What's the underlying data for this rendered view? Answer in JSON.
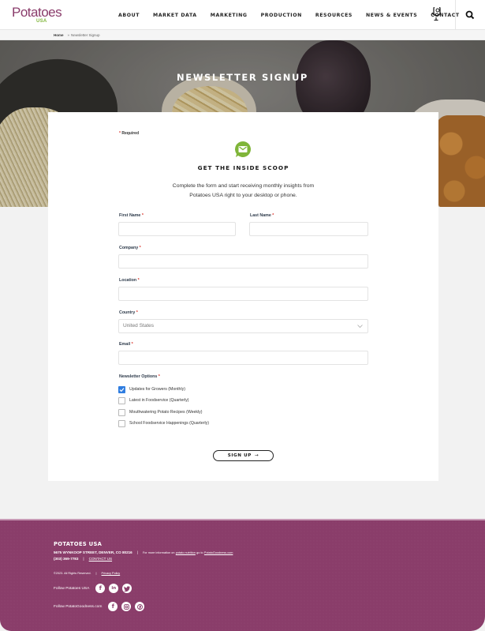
{
  "header": {
    "logo_text": "Potatoes",
    "logo_subtext": "USA",
    "nav": [
      "ABOUT",
      "MARKET DATA",
      "MARKETING",
      "PRODUCTION",
      "RESOURCES",
      "NEWS & EVENTS",
      "CONTACT"
    ],
    "icons": {
      "podcast": "microphone-icon",
      "search": "search-icon"
    }
  },
  "breadcrumb": {
    "home": "Home",
    "separator": "»",
    "current": "Newsletter Signup"
  },
  "hero": {
    "title": "NEWSLETTER SIGNUP"
  },
  "form": {
    "required_note": "Required",
    "required_marker": "*",
    "icon": "email-chat-icon",
    "heading": "GET THE INSIDE SCOOP",
    "description_line1": "Complete the form and start receiving monthly insights from",
    "description_line2": "Potatoes USA right to your desktop or phone.",
    "fields": {
      "first_name": {
        "label": "First Name",
        "value": ""
      },
      "last_name": {
        "label": "Last Name",
        "value": ""
      },
      "company": {
        "label": "Company",
        "value": ""
      },
      "location": {
        "label": "Location",
        "value": ""
      },
      "country": {
        "label": "Country",
        "value": "United States"
      },
      "email": {
        "label": "Email",
        "value": ""
      }
    },
    "newsletter_options_label": "Newsletter Options",
    "options": [
      {
        "label": "Updates for Growers (Monthly)",
        "checked": true
      },
      {
        "label": "Latest in Foodservice (Quarterly)",
        "checked": false
      },
      {
        "label": "Mouthwatering Potato Recipes (Weekly)",
        "checked": false
      },
      {
        "label": "School Foodservice Happenings (Quarterly)",
        "checked": false
      }
    ],
    "submit_label": "SIGN UP",
    "submit_arrow": "→"
  },
  "footer": {
    "title": "POTATOES USA",
    "address": "5675 WYNKOOP STREET, DENVER, CO 80216",
    "info_prefix": "For more information on",
    "info_link": "potato nutrition",
    "info_mid": "go to",
    "info_site": "PotatoGoodness.com",
    "phone": "(303) 369-7783",
    "contact_link": "CONTACT US",
    "copyright": "©2023. All Rights Reserved.",
    "privacy_link": "Privacy Policy",
    "follow_usa_label": "Follow Potatoes USA",
    "follow_usa_icons": [
      "facebook-icon",
      "linkedin-icon",
      "twitter-icon"
    ],
    "follow_goodness_label": "Follow PotatoGoodness.com",
    "follow_goodness_icons": [
      "facebook-icon",
      "instagram-icon",
      "pinterest-icon"
    ]
  },
  "colors": {
    "brand_purple": "#8a3d6a",
    "brand_green": "#7fb539",
    "required_red": "#d9342b",
    "checkbox_blue": "#2f7de0"
  }
}
